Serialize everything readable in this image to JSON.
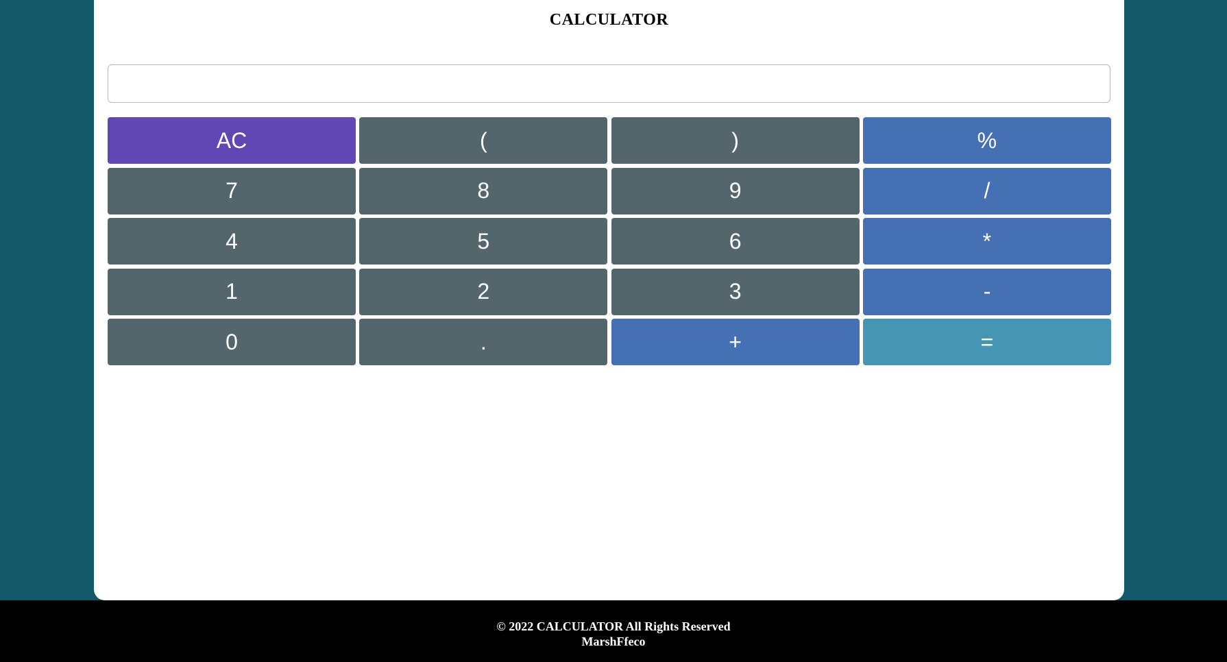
{
  "app": {
    "title": "CALCULATOR"
  },
  "display": {
    "value": "",
    "placeholder": ""
  },
  "keypad": {
    "keys": [
      {
        "label": "AC",
        "role": "clear"
      },
      {
        "label": "(",
        "role": "num"
      },
      {
        "label": ")",
        "role": "num"
      },
      {
        "label": "%",
        "role": "op"
      },
      {
        "label": "7",
        "role": "num"
      },
      {
        "label": "8",
        "role": "num"
      },
      {
        "label": "9",
        "role": "num"
      },
      {
        "label": "/",
        "role": "op"
      },
      {
        "label": "4",
        "role": "num"
      },
      {
        "label": "5",
        "role": "num"
      },
      {
        "label": "6",
        "role": "num"
      },
      {
        "label": "*",
        "role": "op"
      },
      {
        "label": "1",
        "role": "num"
      },
      {
        "label": "2",
        "role": "num"
      },
      {
        "label": "3",
        "role": "num"
      },
      {
        "label": "-",
        "role": "op"
      },
      {
        "label": "0",
        "role": "num"
      },
      {
        "label": ".",
        "role": "num"
      },
      {
        "label": "+",
        "role": "op"
      },
      {
        "label": "=",
        "role": "eq"
      }
    ]
  },
  "footer": {
    "copyright": "© 2022 CALCULATOR All Rights Reserved",
    "author": "MarshFfeco"
  },
  "colors": {
    "page_background": "#135868",
    "card_background": "#ffffff",
    "clear_key": "#6048b4",
    "number_key": "#52666c",
    "operator_key": "#4670b4",
    "equals_key": "#4595b3",
    "footer_background": "#000000"
  }
}
